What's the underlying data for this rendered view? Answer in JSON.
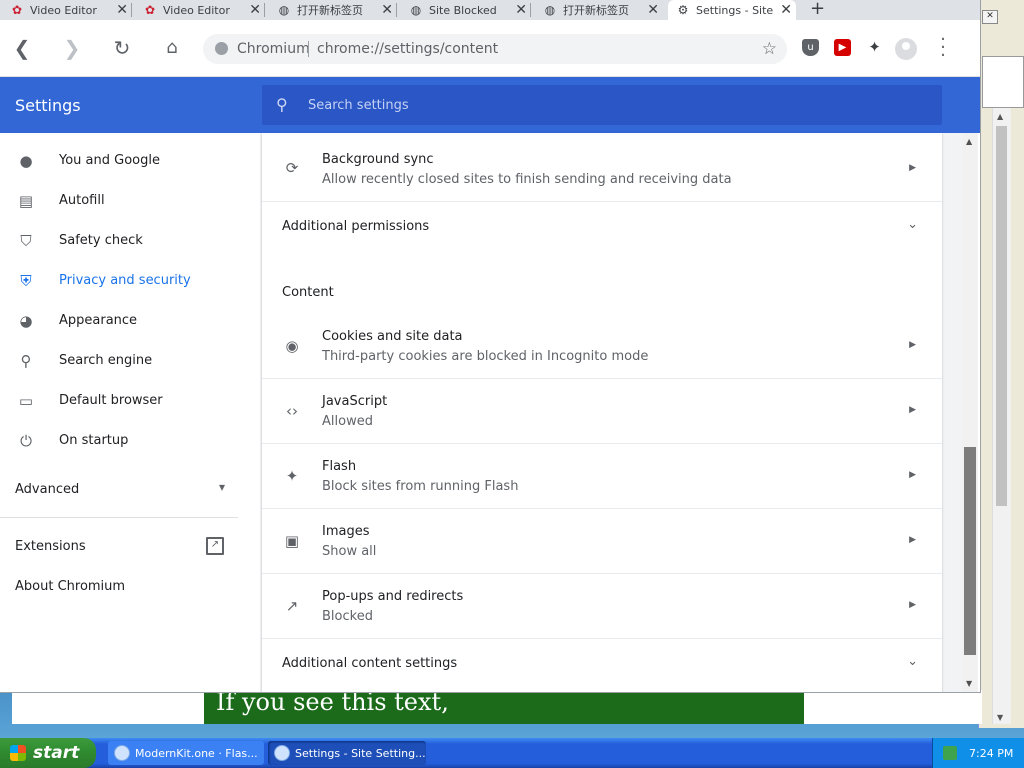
{
  "tabs": [
    {
      "title": "Video Editor",
      "icon": "video-editor-icon"
    },
    {
      "title": "Video Editor",
      "icon": "video-editor-icon"
    },
    {
      "title": "打开新标签页",
      "icon": "globe-icon"
    },
    {
      "title": "Site Blocked",
      "icon": "globe-icon"
    },
    {
      "title": "打开新标签页",
      "icon": "globe-icon"
    },
    {
      "title": "Settings - Site",
      "icon": "gear-icon",
      "active": true
    }
  ],
  "omnibox": {
    "host": "Chromium",
    "url": "chrome://settings/content"
  },
  "header": {
    "title": "Settings",
    "search_placeholder": "Search settings"
  },
  "sidebar": {
    "items": [
      {
        "label": "You and Google",
        "icon": "person-icon"
      },
      {
        "label": "Autofill",
        "icon": "clipboard-icon"
      },
      {
        "label": "Safety check",
        "icon": "shield-check-icon"
      },
      {
        "label": "Privacy and security",
        "icon": "shield-icon",
        "selected": true
      },
      {
        "label": "Appearance",
        "icon": "palette-icon"
      },
      {
        "label": "Search engine",
        "icon": "search-icon"
      },
      {
        "label": "Default browser",
        "icon": "browser-icon"
      },
      {
        "label": "On startup",
        "icon": "power-icon"
      }
    ],
    "advanced": "Advanced",
    "extensions": "Extensions",
    "about": "About Chromium"
  },
  "content": {
    "background_sync": {
      "title": "Background sync",
      "subtitle": "Allow recently closed sites to finish sending and receiving data"
    },
    "additional_permissions": "Additional permissions",
    "section_label": "Content",
    "items": [
      {
        "title": "Cookies and site data",
        "subtitle": "Third-party cookies are blocked in Incognito mode",
        "icon": "cookie-icon"
      },
      {
        "title": "JavaScript",
        "subtitle": "Allowed",
        "icon": "code-icon"
      },
      {
        "title": "Flash",
        "subtitle": "Block sites from running Flash",
        "icon": "puzzle-icon"
      },
      {
        "title": "Images",
        "subtitle": "Show all",
        "icon": "image-icon"
      },
      {
        "title": "Pop-ups and redirects",
        "subtitle": "Blocked",
        "icon": "open-external-icon"
      }
    ],
    "additional_content_settings": "Additional content settings"
  },
  "page_behind": {
    "banner_text": "If you see this text,"
  },
  "taskbar": {
    "start_label": "start",
    "tasks": [
      {
        "label": "ModernKit.one · Flas..."
      },
      {
        "label": "Settings - Site Setting..."
      }
    ],
    "clock": "7:24 PM"
  },
  "colors": {
    "header_blue": "#3367d6",
    "search_blue": "#2a56c6",
    "selected_nav": "#1a73e8",
    "taskbar_blue": "#245edb",
    "start_green": "#2f8a2f"
  }
}
